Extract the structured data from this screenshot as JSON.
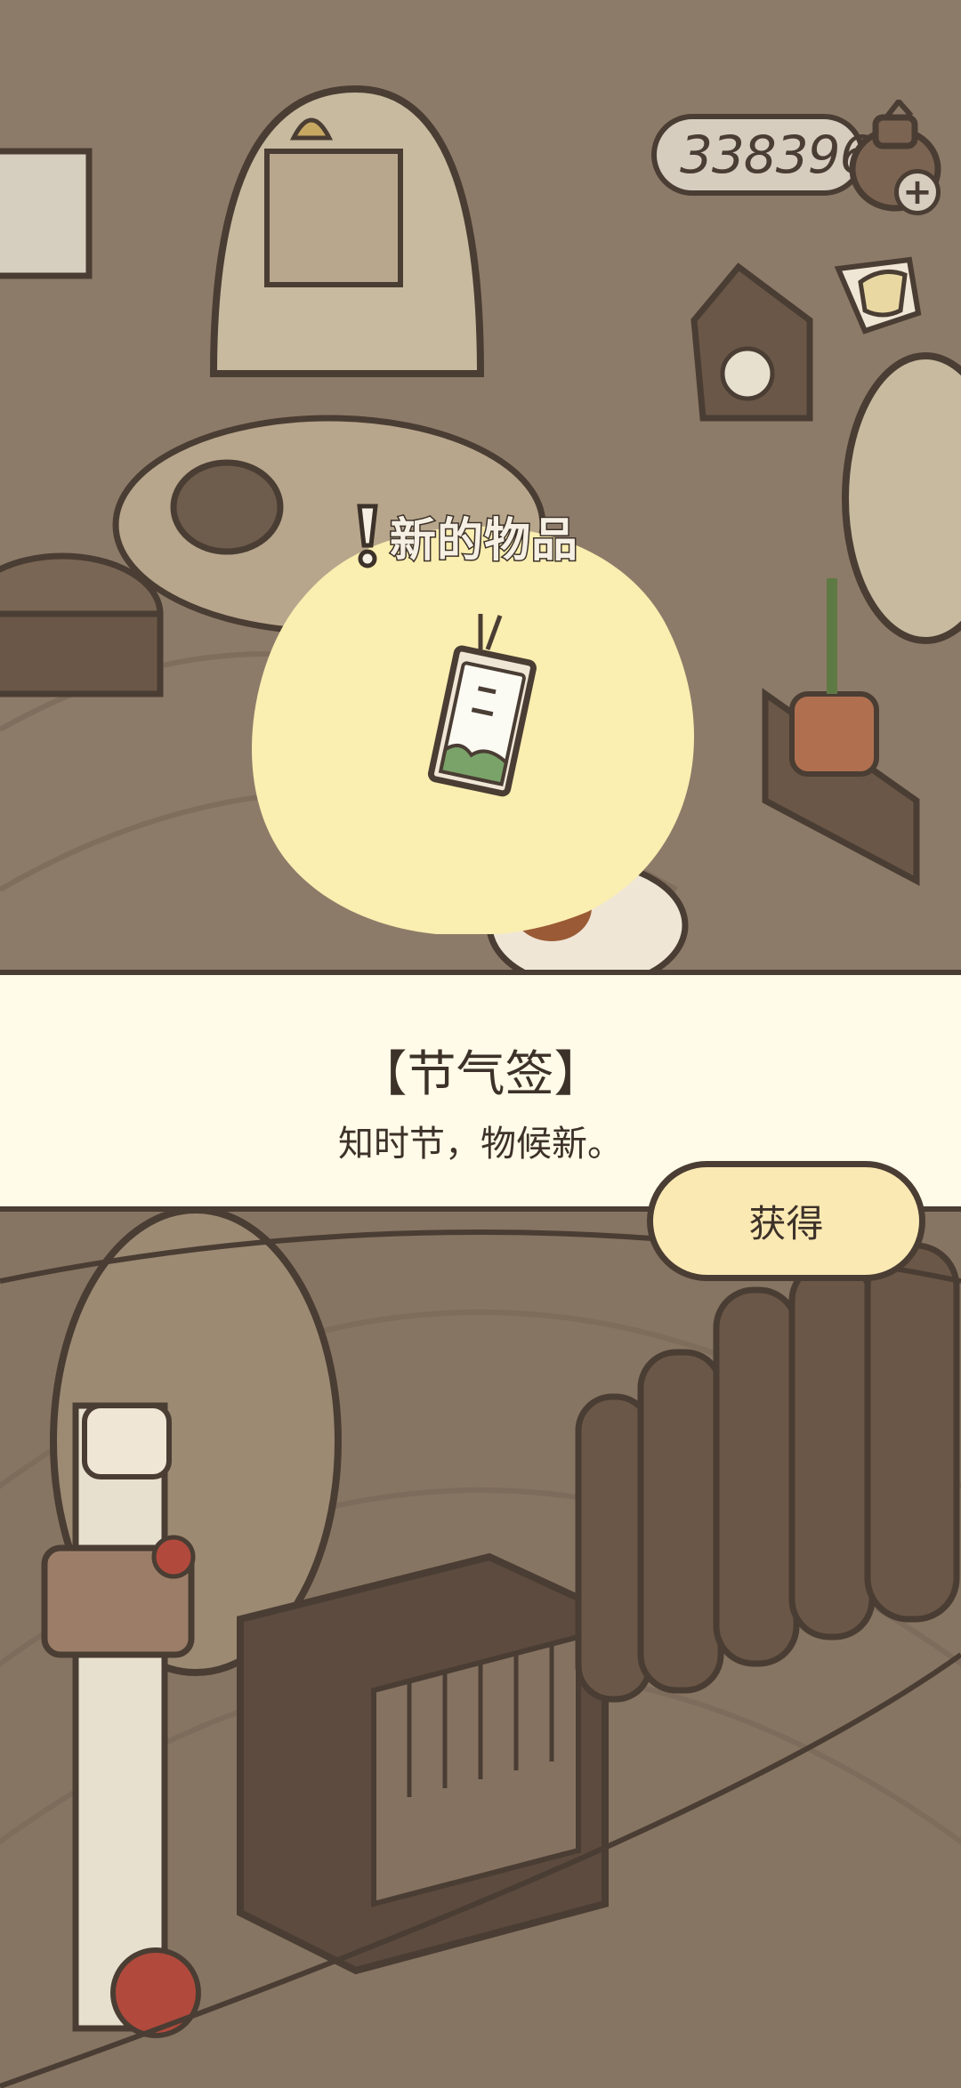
{
  "hud": {
    "currency_amount": "338396",
    "plus_symbol": "+"
  },
  "popup": {
    "header": "新的物品",
    "item_name": "【节气签】",
    "item_description": "知时节，物候新。",
    "obtain_button_label": "获得"
  },
  "icons": {
    "currency": "clover-coin-bag-icon",
    "add": "plus-icon",
    "shortcut": "teacup-icon",
    "alert": "exclamation-icon",
    "item": "solar-term-tag-icon"
  },
  "colors": {
    "background": "#8a7a68",
    "outline": "#4a3d33",
    "highlight_blob": "#faeeb0",
    "banner": "#fffbe8",
    "button": "#fbe9b4"
  }
}
